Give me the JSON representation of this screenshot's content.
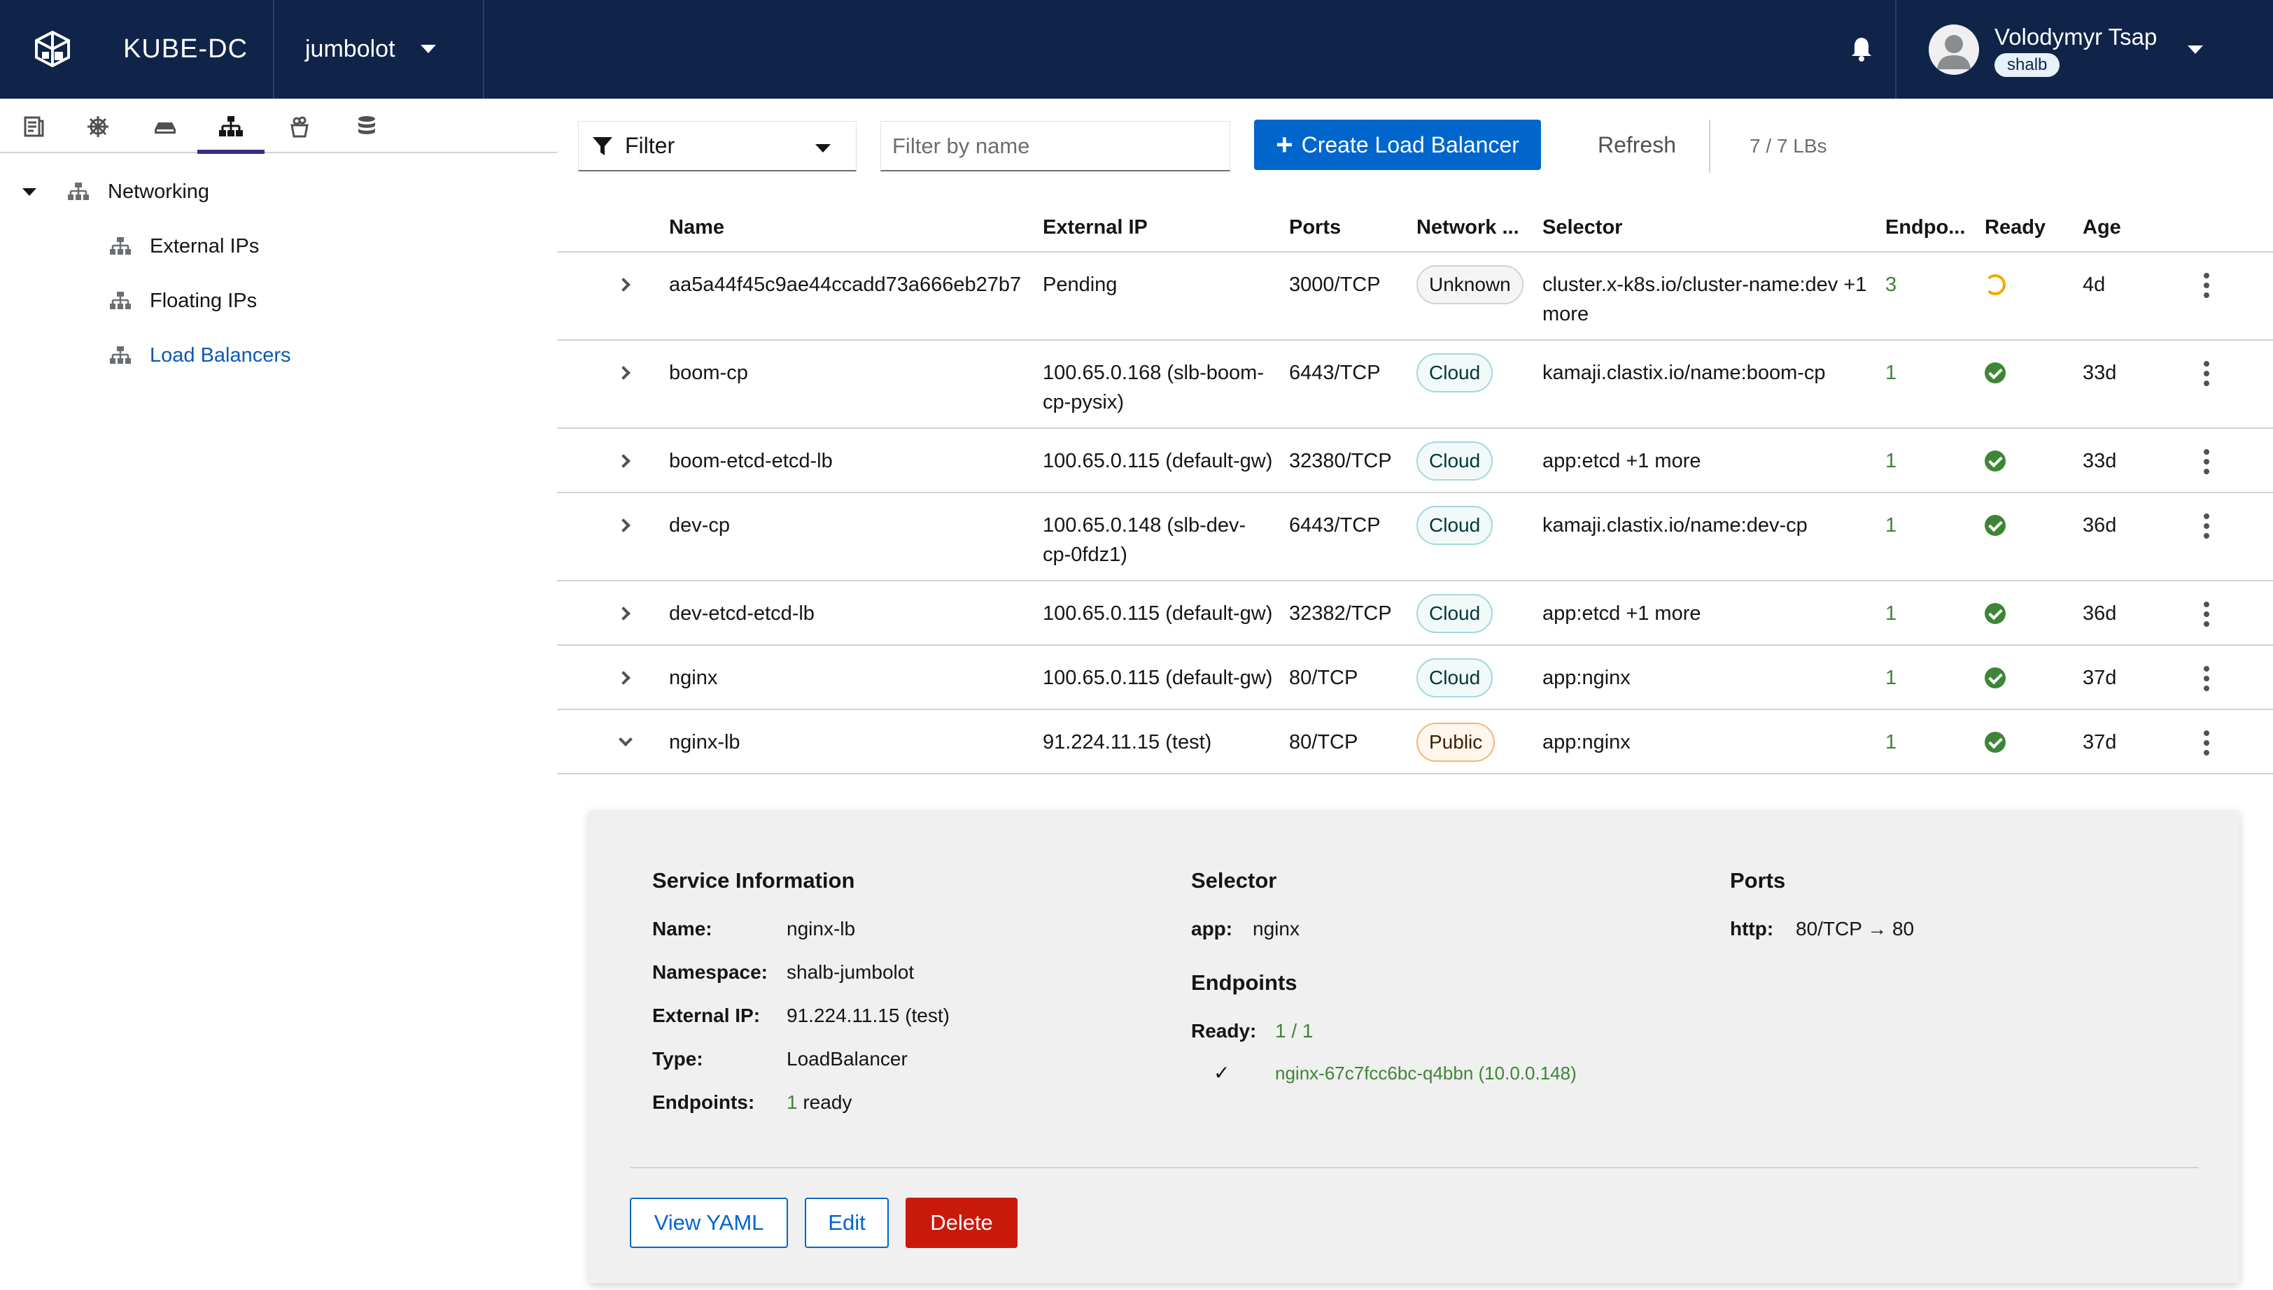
{
  "app": {
    "name": "KUBE-DC",
    "namespace": "jumbolot"
  },
  "user": {
    "name": "Volodymyr Tsap",
    "badge": "shalb"
  },
  "icons": {
    "logo": "cube-logo-icon",
    "bell": "bell-icon",
    "avatar": "user-avatar-icon",
    "side_tabs": [
      "document-icon",
      "helm-wheel-icon",
      "drive-icon",
      "network-icon",
      "container-icon",
      "database-icon"
    ]
  },
  "sidebar": {
    "section": "Networking",
    "items": [
      {
        "label": "External IPs",
        "active": false
      },
      {
        "label": "Floating IPs",
        "active": false
      },
      {
        "label": "Load Balancers",
        "active": true
      }
    ]
  },
  "toolbar": {
    "filter_label": "Filter",
    "search_placeholder": "Filter by name",
    "create_label": "Create Load Balancer",
    "refresh_label": "Refresh",
    "count": "7 / 7 LBs"
  },
  "table": {
    "headers": {
      "name": "Name",
      "external_ip": "External IP",
      "ports": "Ports",
      "network": "Network ...",
      "selector": "Selector",
      "endpoints": "Endpo...",
      "ready": "Ready",
      "age": "Age"
    },
    "rows": [
      {
        "name": "aa5a44f45c9ae44ccadd73a666eb27b7",
        "ip1": "Pending",
        "ip2": "",
        "ports": "3000/TCP",
        "network": "Unknown",
        "sel1": "cluster.x-k8s.io/cluster-name:dev +1",
        "sel2": "more",
        "endpoints": "3",
        "ready": "pending",
        "age": "4d",
        "expanded": false
      },
      {
        "name": "boom-cp",
        "ip1": "100.65.0.168 (slb-boom-",
        "ip2": "cp-pysix)",
        "ports": "6443/TCP",
        "network": "Cloud",
        "sel1": "kamaji.clastix.io/name:boom-cp",
        "sel2": "",
        "endpoints": "1",
        "ready": "ok",
        "age": "33d",
        "expanded": false
      },
      {
        "name": "boom-etcd-etcd-lb",
        "ip1": "100.65.0.115 (default-gw)",
        "ip2": "",
        "ports": "32380/TCP",
        "network": "Cloud",
        "sel1": "app:etcd +1 more",
        "sel2": "",
        "endpoints": "1",
        "ready": "ok",
        "age": "33d",
        "expanded": false
      },
      {
        "name": "dev-cp",
        "ip1": "100.65.0.148 (slb-dev-",
        "ip2": "cp-0fdz1)",
        "ports": "6443/TCP",
        "network": "Cloud",
        "sel1": "kamaji.clastix.io/name:dev-cp",
        "sel2": "",
        "endpoints": "1",
        "ready": "ok",
        "age": "36d",
        "expanded": false
      },
      {
        "name": "dev-etcd-etcd-lb",
        "ip1": "100.65.0.115 (default-gw)",
        "ip2": "",
        "ports": "32382/TCP",
        "network": "Cloud",
        "sel1": "app:etcd +1 more",
        "sel2": "",
        "endpoints": "1",
        "ready": "ok",
        "age": "36d",
        "expanded": false
      },
      {
        "name": "nginx",
        "ip1": "100.65.0.115 (default-gw)",
        "ip2": "",
        "ports": "80/TCP",
        "network": "Cloud",
        "sel1": "app:nginx",
        "sel2": "",
        "endpoints": "1",
        "ready": "ok",
        "age": "37d",
        "expanded": false
      },
      {
        "name": "nginx-lb",
        "ip1": "91.224.11.15 (test)",
        "ip2": "",
        "ports": "80/TCP",
        "network": "Public",
        "sel1": "app:nginx",
        "sel2": "",
        "endpoints": "1",
        "ready": "ok",
        "age": "37d",
        "expanded": true
      }
    ]
  },
  "details": {
    "service_heading": "Service Information",
    "fields": [
      {
        "key": "Name:",
        "value": "nginx-lb"
      },
      {
        "key": "Namespace:",
        "value": "shalb-jumbolot"
      },
      {
        "key": "External IP:",
        "value": "91.224.11.15 (test)"
      },
      {
        "key": "Type:",
        "value": "LoadBalancer"
      },
      {
        "key": "Endpoints:",
        "count": "1",
        "value": "ready"
      }
    ],
    "selector_heading": "Selector",
    "selector": {
      "key": "app:",
      "value": "nginx"
    },
    "endpoints_heading": "Endpoints",
    "endpoints_ready_key": "Ready:",
    "endpoints_ready_value": "1 / 1",
    "endpoint_check": "✓",
    "endpoint_item": "nginx-67c7fcc6bc-q4bbn (10.0.0.148)",
    "ports_heading": "Ports",
    "port": {
      "key": "http:",
      "value": "80/TCP → 80"
    },
    "buttons": {
      "view_yaml": "View YAML",
      "edit": "Edit",
      "delete": "Delete"
    }
  }
}
